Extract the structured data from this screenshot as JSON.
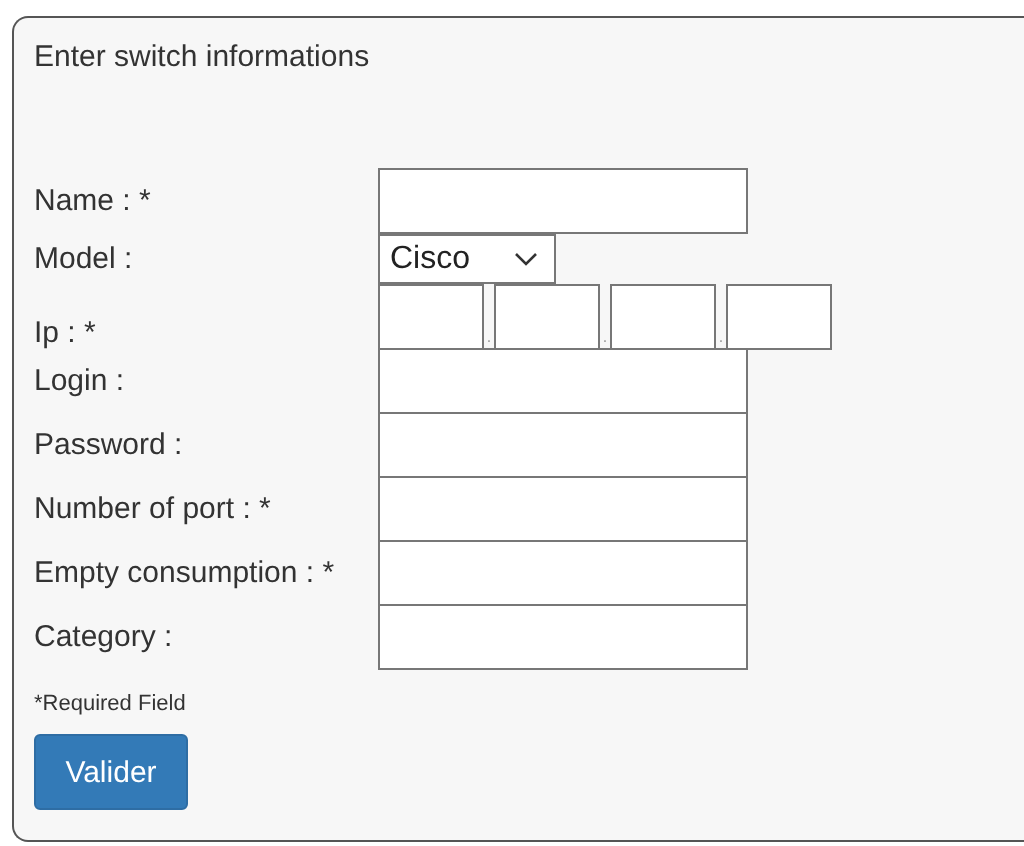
{
  "panel": {
    "title": "Enter switch informations"
  },
  "fields": [
    {
      "label": "Name : *",
      "kind": "text"
    },
    {
      "label": "Model :",
      "kind": "select",
      "value": "Cisco"
    },
    {
      "label": "Ip : *",
      "kind": "ip",
      "separator": "."
    },
    {
      "label": "Login :",
      "kind": "text"
    },
    {
      "label": "Password :",
      "kind": "text"
    },
    {
      "label": "Number of port : *",
      "kind": "text"
    },
    {
      "label": "Empty consumption : *",
      "kind": "text"
    },
    {
      "label": "Category :",
      "kind": "text"
    }
  ],
  "note": "*Required Field",
  "buttons": [
    "Valider"
  ]
}
